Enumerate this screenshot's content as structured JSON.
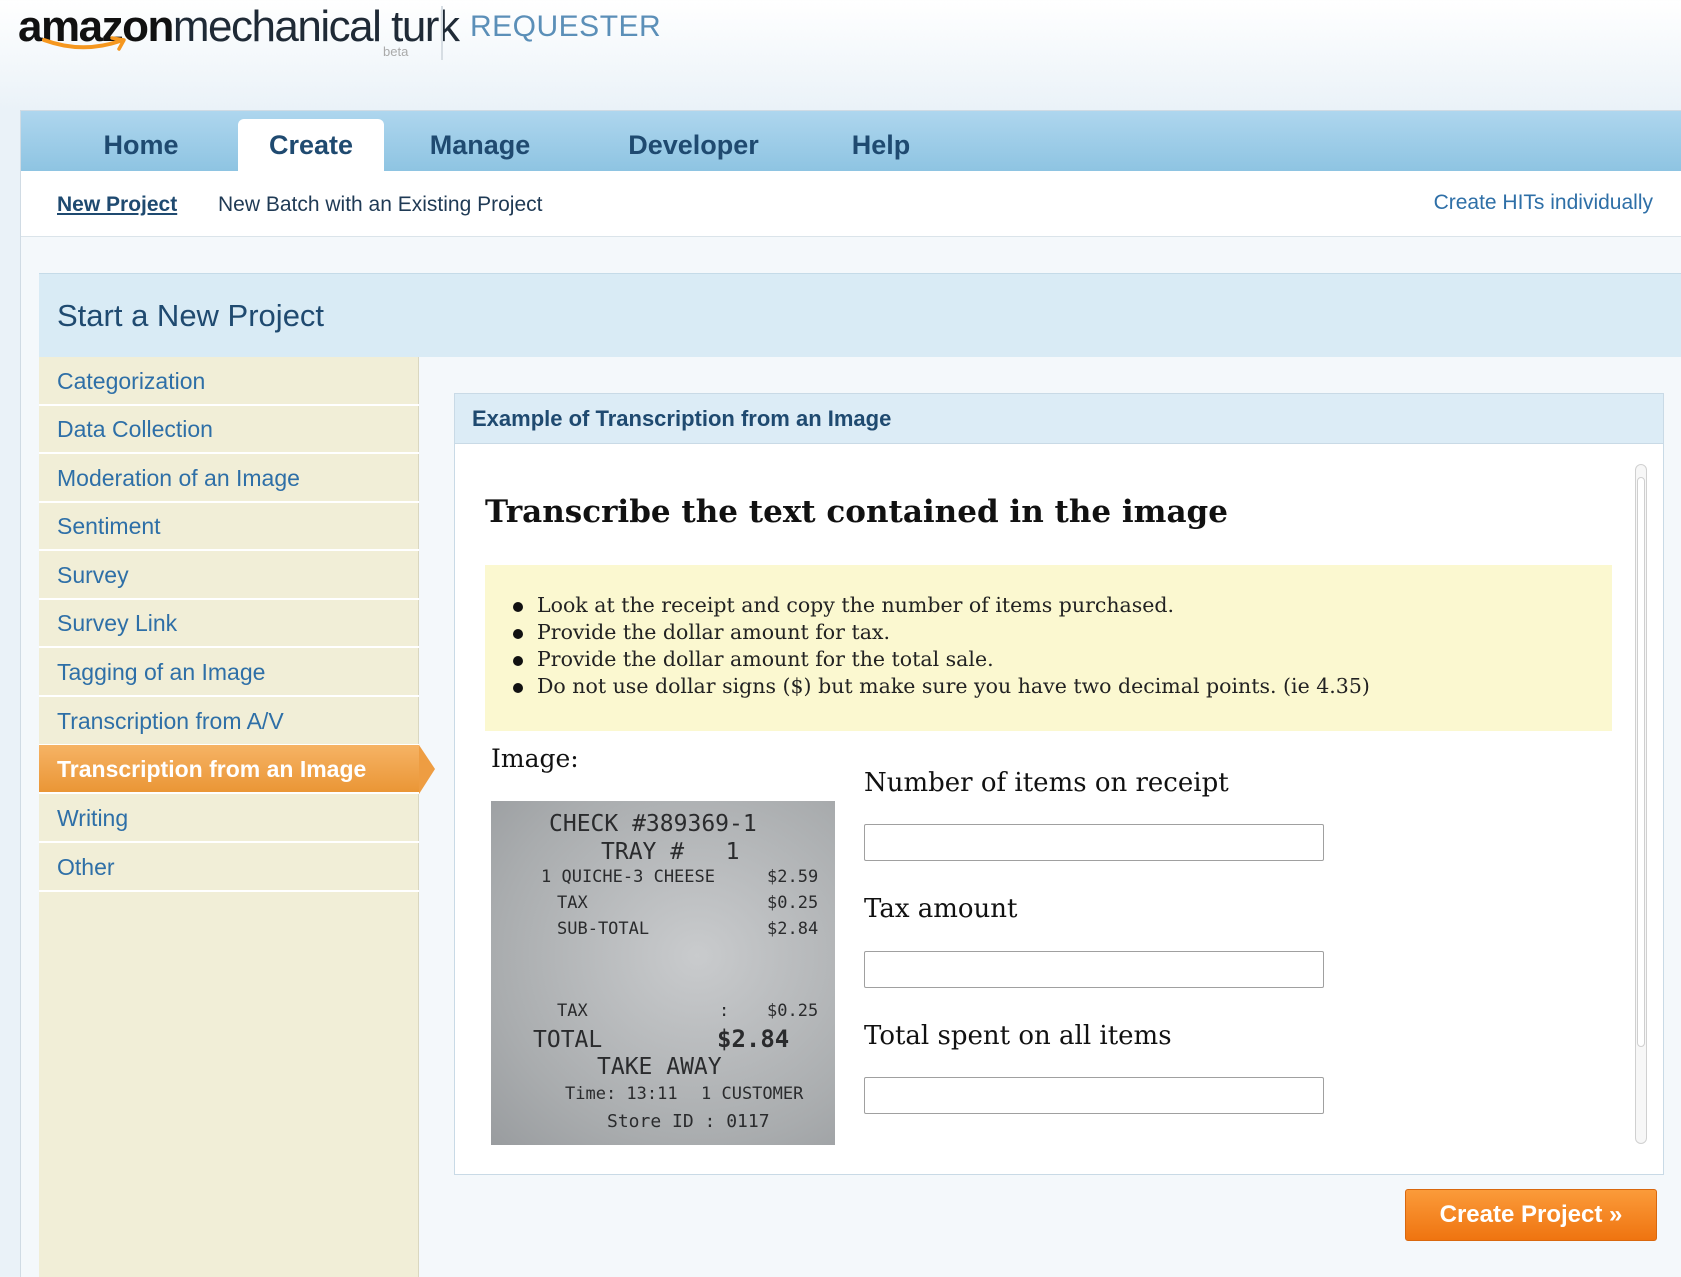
{
  "header": {
    "brand_amazon": "amazon",
    "brand_mturk": "mechanical turk",
    "brand_beta": "beta",
    "section": "REQUESTER"
  },
  "nav": {
    "tabs": [
      {
        "label": "Home"
      },
      {
        "label": "Create"
      },
      {
        "label": "Manage"
      },
      {
        "label": "Developer"
      },
      {
        "label": "Help"
      }
    ],
    "active_tab": "Create"
  },
  "subnav": {
    "new_project": "New Project",
    "new_batch": "New Batch with an Existing Project",
    "create_individually": "Create HITs individually"
  },
  "page_title": "Start a New Project",
  "sidebar": {
    "items": [
      {
        "label": "Categorization"
      },
      {
        "label": "Data Collection"
      },
      {
        "label": "Moderation of an Image"
      },
      {
        "label": "Sentiment"
      },
      {
        "label": "Survey"
      },
      {
        "label": "Survey Link"
      },
      {
        "label": "Tagging of an Image"
      },
      {
        "label": "Transcription from A/V"
      },
      {
        "label": "Transcription from an Image"
      },
      {
        "label": "Writing"
      },
      {
        "label": "Other"
      }
    ],
    "active_item": "Transcription from an Image"
  },
  "example": {
    "header": "Example of Transcription from an Image",
    "hit_title": "Transcribe the text contained in the image",
    "instructions": [
      "Look at the receipt and copy the number of items purchased.",
      "Provide the dollar amount for tax.",
      "Provide the dollar amount for the total sale.",
      "Do not use dollar signs ($) but make sure you have two decimal points. (ie 4.35)"
    ],
    "image_label": "Image:",
    "receipt": {
      "check": "CHECK #389369-1",
      "tray": "TRAY #   1",
      "item": "1 QUICHE-3 CHEESE",
      "item_price": "$2.59",
      "tax_label": "TAX",
      "tax_value": "$0.25",
      "subtotal_label": "SUB-TOTAL",
      "subtotal_value": "$2.84",
      "tax2_label": "TAX",
      "tax2_sep": ":",
      "tax2_value": "$0.25",
      "total_label": "TOTAL",
      "total_value": "$2.84",
      "takeaway": "TAKE AWAY",
      "time": "Time: 13:11",
      "customer": "1 CUSTOMER",
      "store": "Store ID : 0117"
    },
    "fields": [
      {
        "label": "Number of items on receipt",
        "value": ""
      },
      {
        "label": "Tax amount",
        "value": ""
      },
      {
        "label": "Total spent on all items",
        "value": ""
      }
    ]
  },
  "create_button": "Create Project »",
  "colors": {
    "nav_bar": "#9ccbe7",
    "sidebar_bg": "#f1eed7",
    "active_item": "#f0a04b",
    "link": "#2e6fa7",
    "button": "#f58220"
  }
}
